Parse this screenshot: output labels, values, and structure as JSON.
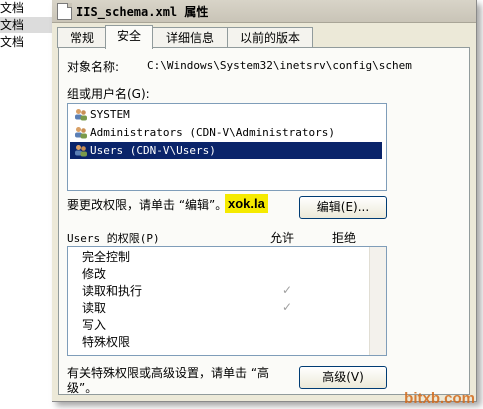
{
  "left_panel": {
    "items": [
      "文档",
      "文档",
      "文档"
    ]
  },
  "window": {
    "title": "IIS_schema.xml 属性"
  },
  "tabs": [
    "常规",
    "安全",
    "详细信息",
    "以前的版本"
  ],
  "security": {
    "object_name_label": "对象名称:",
    "object_name_value": "C:\\Windows\\System32\\inetsrv\\config\\schem",
    "groups_label": "组或用户名(G):",
    "users": [
      "SYSTEM",
      "Administrators (CDN-V\\Administrators)",
      "Users (CDN-V\\Users)"
    ],
    "change_hint": "要更改权限，请单击 “编辑”。",
    "edit_button": "编辑(E)...",
    "callout": "xok.la",
    "perm_header": "Users 的权限(P)",
    "allow_header": "允许",
    "deny_header": "拒绝",
    "permissions": [
      {
        "name": "完全控制",
        "allow": ""
      },
      {
        "name": "修改",
        "allow": ""
      },
      {
        "name": "读取和执行",
        "allow": "✓"
      },
      {
        "name": "读取",
        "allow": "✓"
      },
      {
        "name": "写入",
        "allow": ""
      },
      {
        "name": "特殊权限",
        "allow": ""
      }
    ],
    "advanced_hint_1": "有关特殊权限或高级设置，请单击 “高",
    "advanced_hint_2": "级”。",
    "advanced_button": "高级(V)"
  },
  "watermark": "bitxb.com",
  "colors": {
    "selection": "#0a246a",
    "callout": "#f5ea00",
    "dialog_bg": "#ece9d8"
  }
}
